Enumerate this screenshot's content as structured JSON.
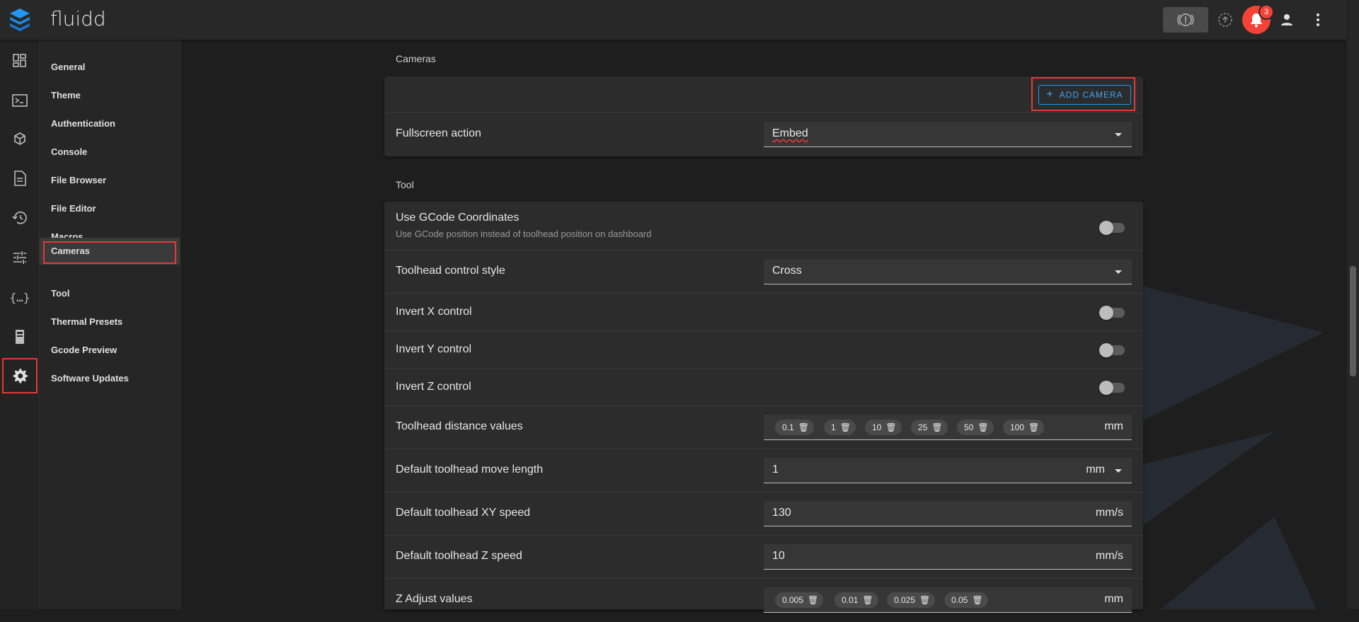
{
  "app": {
    "title": "fluidd",
    "notification_count": "3"
  },
  "nav": {
    "items": [
      {
        "label": "General"
      },
      {
        "label": "Theme"
      },
      {
        "label": "Authentication"
      },
      {
        "label": "Console"
      },
      {
        "label": "File Browser"
      },
      {
        "label": "File Editor"
      },
      {
        "label": "Macros"
      },
      {
        "label": "Cameras"
      },
      {
        "label": "Tool"
      },
      {
        "label": "Thermal Presets"
      },
      {
        "label": "Gcode Preview"
      },
      {
        "label": "Software Updates"
      }
    ],
    "active": "Cameras"
  },
  "rail_icons": [
    "dashboard-icon",
    "console-icon",
    "printer-3d-icon",
    "file-document-icon",
    "history-icon",
    "tune-icon",
    "code-braces-icon",
    "device-icon",
    "settings-gear-icon"
  ],
  "cameras": {
    "section_title": "Cameras",
    "add_camera_label": "ADD CAMERA",
    "fullscreen_label": "Fullscreen action",
    "fullscreen_value": "Embed"
  },
  "tool": {
    "section_title": "Tool",
    "use_gcode_label": "Use GCode Coordinates",
    "use_gcode_sub": "Use GCode position instead of toolhead position on dashboard",
    "control_style_label": "Toolhead control style",
    "control_style_value": "Cross",
    "invert_x_label": "Invert X control",
    "invert_y_label": "Invert Y control",
    "invert_z_label": "Invert Z control",
    "distance_label": "Toolhead distance values",
    "distance_values": [
      "0.1",
      "1",
      "10",
      "25",
      "50",
      "100"
    ],
    "distance_unit": "mm",
    "move_length_label": "Default toolhead move length",
    "move_length_value": "1",
    "move_length_unit": "mm",
    "xy_speed_label": "Default toolhead XY speed",
    "xy_speed_value": "130",
    "xy_speed_unit": "mm/s",
    "z_speed_label": "Default toolhead Z speed",
    "z_speed_value": "10",
    "z_speed_unit": "mm/s",
    "z_adjust_label": "Z Adjust values",
    "z_adjust_values": [
      "0.005",
      "0.01",
      "0.025",
      "0.05"
    ],
    "z_adjust_unit": "mm"
  },
  "colors": {
    "accent": "#2196f3",
    "alert": "#f44336",
    "highlight": "#e53935"
  }
}
